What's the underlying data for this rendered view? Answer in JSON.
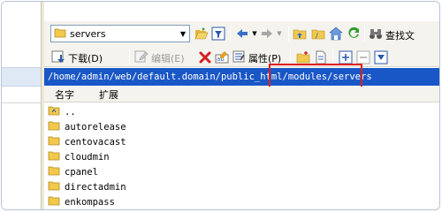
{
  "toolbar": {
    "path_combo": {
      "value": "servers",
      "icon": "folder-icon"
    },
    "download_label": "下载(D)",
    "edit_label": "编辑(E)",
    "properties_label": "属性(P)",
    "find_label": "查找文"
  },
  "path": {
    "current": "/home/admin/web/default.domain/public_html/modules/servers"
  },
  "list": {
    "columns": [
      {
        "label": "名字"
      },
      {
        "label": "扩展"
      }
    ],
    "items": [
      {
        "name": "..",
        "type": "parent-folder"
      },
      {
        "name": "autorelease",
        "type": "folder"
      },
      {
        "name": "centovacast",
        "type": "folder"
      },
      {
        "name": "cloudmin",
        "type": "folder"
      },
      {
        "name": "cpanel",
        "type": "folder"
      },
      {
        "name": "directadmin",
        "type": "folder"
      },
      {
        "name": "enkompass",
        "type": "folder"
      }
    ]
  },
  "colors": {
    "path_bg": "#1a57c6",
    "highlight_box": "#e02020",
    "folder": "#f2c94c"
  }
}
